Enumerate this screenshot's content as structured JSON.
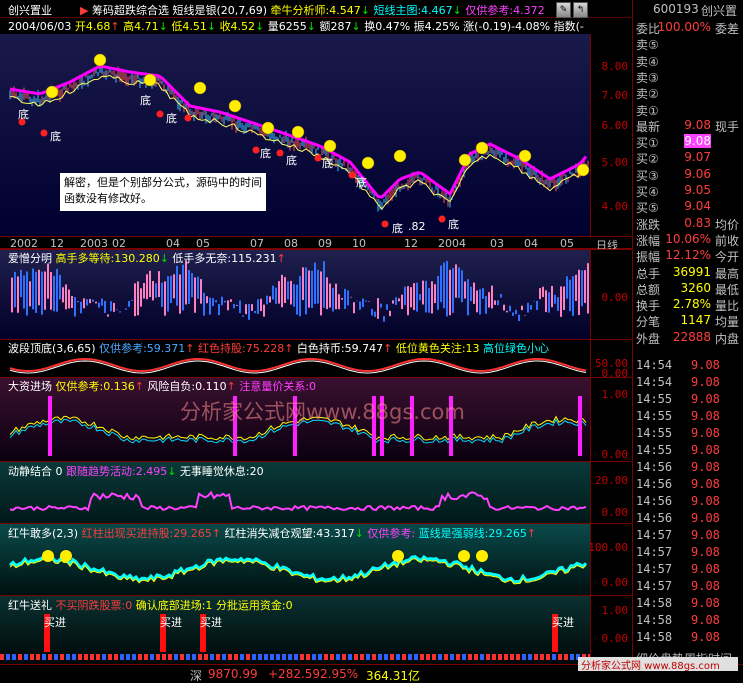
{
  "toolbar": {
    "stock_name": "创兴置业",
    "indicator_title": "筹码超跌综合选",
    "line1_prefix": "短线是银(20,7,69)",
    "line1_a": "牵牛分析师:4.547",
    "line1_b": "短线主图:4.467",
    "line1_c": "仅供参考:4.372"
  },
  "infoline": {
    "date": "2004/06/03",
    "open": "开4.68",
    "high": "高4.71",
    "low": "低4.51",
    "close": "收4.52",
    "volume": "量6255",
    "amount": "额287",
    "turnover": "换0.47%",
    "amplitude": "振4.25%",
    "change": "涨(-0.19)-4.08%",
    "index_label": "指数(-"
  },
  "main_axis": [
    "8.00",
    "7.00",
    "6.00",
    "5.00",
    "4.00"
  ],
  "main_labels": {
    "bottom_mark": "底",
    "top_mark": "顶",
    "low_price": ".82",
    "high_marker": "底"
  },
  "note": "解密，但是个别部分公式，源码中的时间函数没有修改好。",
  "dates": [
    "2002",
    "12",
    "2003",
    "02",
    "04",
    "05",
    "07",
    "08",
    "09",
    "10",
    "12",
    "2004",
    "03",
    "04",
    "05"
  ],
  "date_suffix": "日线",
  "panels": {
    "p1": {
      "title": "爱憎分明",
      "a": "高手多等待:130.280",
      "b": "低手多无奈:115.231",
      "axis": [
        "0.00"
      ]
    },
    "p2": {
      "title": "波段顶底(3,6,65)",
      "a": "仅供参考:59.371",
      "b": "红色持股:75.228",
      "c": "白色持币:59.747",
      "d": "低位黄色关注:13",
      "e": "高位绿色小心",
      "axis": [
        "50.00",
        "0.00"
      ]
    },
    "p3": {
      "title": "大资进场",
      "a": "仅供参考:0.136",
      "b": "风险自负:0.110",
      "c": "注意量价关系:0",
      "axis": [
        "1.00",
        "0.00"
      ]
    },
    "p4": {
      "title": "动静结合",
      "a": "0",
      "b": "跟随趋势活动:2.495",
      "c": "无事睡觉休息:20",
      "axis": [
        "20.00",
        "0.00"
      ]
    },
    "p5": {
      "title": "红牛敢多(2,3)",
      "a": "红柱出现买进持股:29.265",
      "b": "红柱消失减仓观望:43.317",
      "c": "仅供参考:",
      "d": "蓝线是强弱线:29.265",
      "axis": [
        "100.00",
        "0.00"
      ]
    },
    "p6": {
      "title": "红牛送礼",
      "a": "不买阴跌股票:0",
      "b": "确认底部进场:1",
      "c": "分批运用资金:0",
      "axis": [
        "1.00",
        "0.00"
      ],
      "buy": "买进"
    }
  },
  "watermark": "分析家公式网www.88gs.com",
  "right": {
    "code": "600193",
    "name": "创兴置",
    "rows": [
      {
        "k": "委比",
        "v": "100.00%",
        "t": "委差",
        "c": "red"
      },
      {
        "k": "卖⑤",
        "v": "",
        "t": "",
        "c": "white"
      },
      {
        "k": "卖④",
        "v": "",
        "t": "",
        "c": "white"
      },
      {
        "k": "卖③",
        "v": "",
        "t": "",
        "c": "white"
      },
      {
        "k": "卖②",
        "v": "",
        "t": "",
        "c": "white"
      },
      {
        "k": "卖①",
        "v": "",
        "t": "",
        "c": "white"
      },
      {
        "k": "最新",
        "v": "9.08",
        "t": "现手",
        "c": "red"
      },
      {
        "k": "买①",
        "v": "9.08",
        "t": "",
        "c": "red"
      },
      {
        "k": "买②",
        "v": "9.07",
        "t": "",
        "c": "red"
      },
      {
        "k": "买③",
        "v": "9.06",
        "t": "",
        "c": "red"
      },
      {
        "k": "买④",
        "v": "9.05",
        "t": "",
        "c": "red"
      },
      {
        "k": "买⑤",
        "v": "9.04",
        "t": "",
        "c": "red"
      },
      {
        "k": "涨跌",
        "v": "0.83",
        "t": "均价",
        "c": "red"
      },
      {
        "k": "涨幅",
        "v": "10.06%",
        "t": "前收",
        "c": "red"
      },
      {
        "k": "振幅",
        "v": "12.12%",
        "t": "今开",
        "c": "red"
      },
      {
        "k": "总手",
        "v": "36991",
        "t": "最高",
        "c": "yellow"
      },
      {
        "k": "总额",
        "v": "3260",
        "t": "最低",
        "c": "yellow"
      },
      {
        "k": "换手",
        "v": "2.78%",
        "t": "量比",
        "c": "yellow"
      },
      {
        "k": "分笔",
        "v": "1147",
        "t": "均量",
        "c": "yellow"
      },
      {
        "k": "外盘",
        "v": "22888",
        "t": "内盘",
        "c": "red"
      }
    ],
    "ticks": [
      {
        "tm": "14:54",
        "pr": "9.08"
      },
      {
        "tm": "14:54",
        "pr": "9.08"
      },
      {
        "tm": "14:55",
        "pr": "9.08"
      },
      {
        "tm": "14:55",
        "pr": "9.08"
      },
      {
        "tm": "14:55",
        "pr": "9.08"
      },
      {
        "tm": "14:55",
        "pr": "9.08"
      },
      {
        "tm": "14:56",
        "pr": "9.08"
      },
      {
        "tm": "14:56",
        "pr": "9.08"
      },
      {
        "tm": "14:56",
        "pr": "9.08"
      },
      {
        "tm": "14:56",
        "pr": "9.08"
      },
      {
        "tm": "14:57",
        "pr": "9.08"
      },
      {
        "tm": "14:57",
        "pr": "9.08"
      },
      {
        "tm": "14:57",
        "pr": "9.08"
      },
      {
        "tm": "14:57",
        "pr": "9.08"
      },
      {
        "tm": "14:58",
        "pr": "9.08"
      },
      {
        "tm": "14:58",
        "pr": "9.08"
      },
      {
        "tm": "14:58",
        "pr": "9.08"
      }
    ],
    "footer": "细价盘势周指时间"
  },
  "status": {
    "market": "深",
    "index": "9870.99",
    "change": "+282.59",
    "pct": "2.95%",
    "amount": "364.31亿"
  },
  "brand": "分析家公式网 www.88gs.com",
  "colors": {
    "up": "#ff3c3c",
    "down": "#00e000",
    "ma": "#ff00ff",
    "axis": "#c00000"
  }
}
